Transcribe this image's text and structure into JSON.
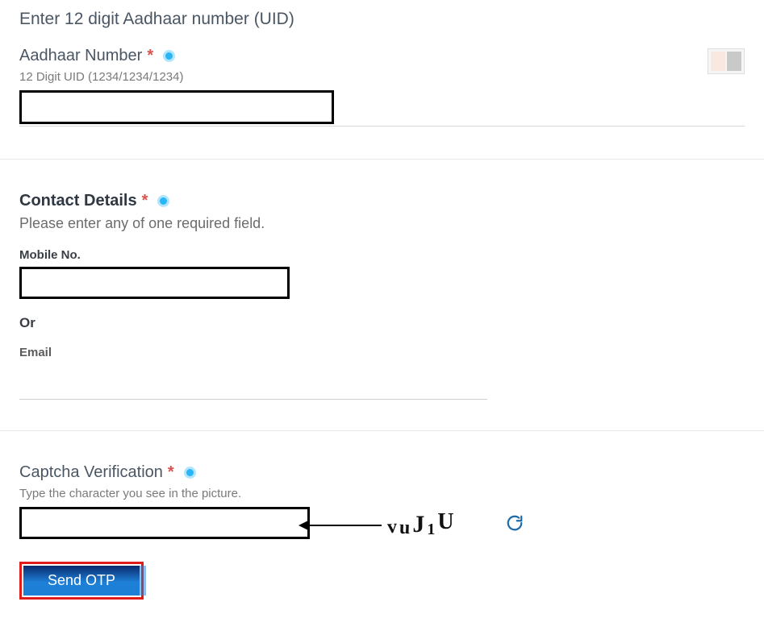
{
  "section1": {
    "title": "Enter 12 digit Aadhaar number (UID)",
    "label": "Aadhaar Number",
    "required": "*",
    "hint": "12 Digit UID (1234/1234/1234)"
  },
  "section2": {
    "title": "Contact Details",
    "required": "*",
    "subtitle": "Please enter any of one required field.",
    "mobile_label": "Mobile No.",
    "or_label": "Or",
    "email_label": "Email"
  },
  "section3": {
    "title": "Captcha Verification",
    "required": "*",
    "hint": "Type the character you see in the picture.",
    "captcha_chars": {
      "c1": "v",
      "c2": "u",
      "c3": "J",
      "c4": "1",
      "c5": "U"
    }
  },
  "button": {
    "send_label": "Send OTP"
  }
}
